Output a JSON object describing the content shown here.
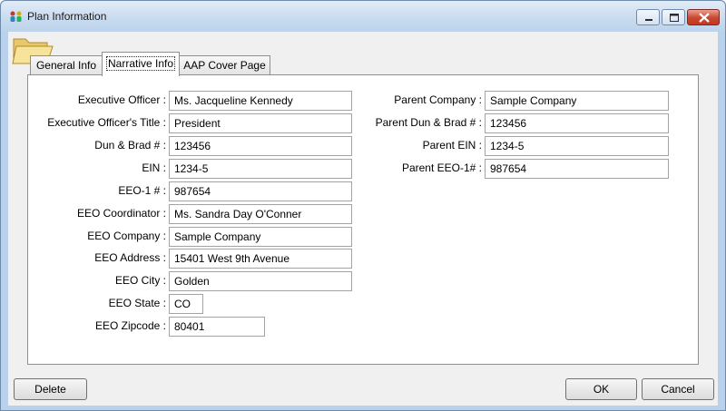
{
  "window": {
    "title": "Plan Information"
  },
  "tabs": [
    {
      "label": "General Info"
    },
    {
      "label": "Narrative Info"
    },
    {
      "label": "AAP Cover Page"
    }
  ],
  "left_fields": [
    {
      "label": "Executive Officer :",
      "value": "Ms. Jacqueline Kennedy"
    },
    {
      "label": "Executive Officer's Title :",
      "value": "President"
    },
    {
      "label": "Dun & Brad # :",
      "value": "123456"
    },
    {
      "label": "EIN :",
      "value": "1234-5"
    },
    {
      "label": "EEO-1 # :",
      "value": "987654"
    },
    {
      "label": "EEO Coordinator :",
      "value": "Ms. Sandra Day O'Conner"
    },
    {
      "label": "EEO Company :",
      "value": "Sample Company"
    },
    {
      "label": "EEO Address :",
      "value": "15401 West 9th Avenue"
    },
    {
      "label": "EEO City :",
      "value": "Golden"
    },
    {
      "label": "EEO State :",
      "value": "CO"
    },
    {
      "label": "EEO Zipcode :",
      "value": "80401"
    }
  ],
  "right_fields": [
    {
      "label": "Parent Company :",
      "value": "Sample Company"
    },
    {
      "label": "Parent Dun & Brad # :",
      "value": "123456"
    },
    {
      "label": "Parent EIN :",
      "value": "1234-5"
    },
    {
      "label": "Parent EEO-1# :",
      "value": "987654"
    }
  ],
  "buttons": {
    "delete": "Delete",
    "ok": "OK",
    "cancel": "Cancel"
  }
}
